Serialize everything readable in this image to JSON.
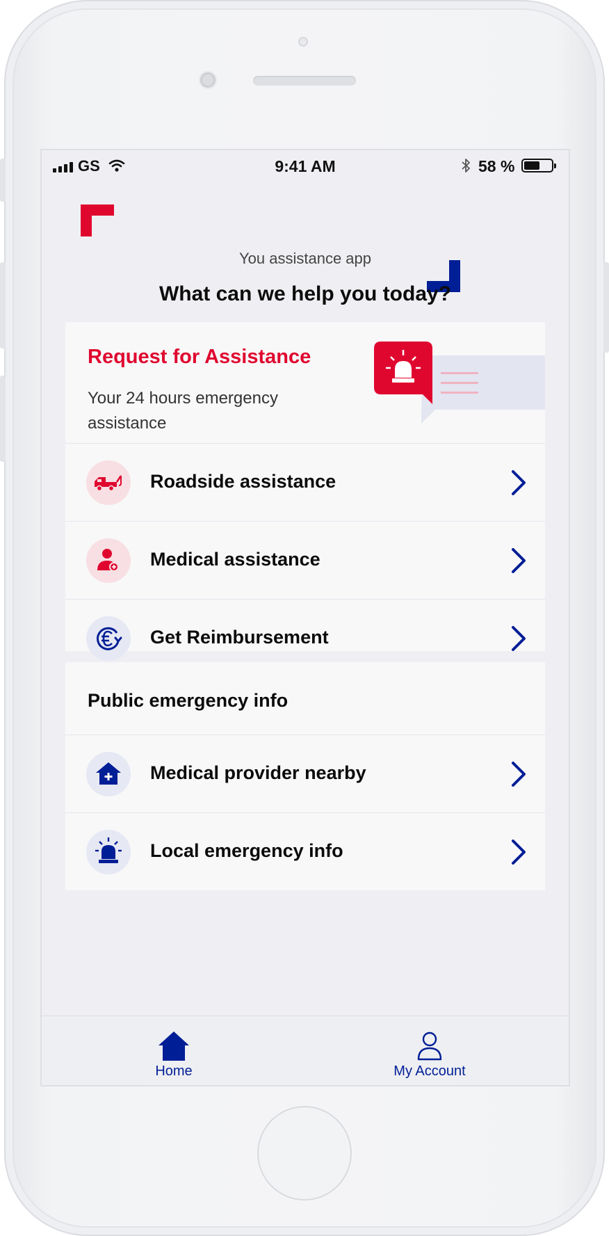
{
  "status_bar": {
    "carrier": "GS",
    "time": "9:41 AM",
    "battery": "58 %",
    "battery_level": 0.58
  },
  "header": {
    "subtitle": "You assistance app",
    "title": "What can we help you today?"
  },
  "request_card": {
    "title": "Request for Assistance",
    "description": "Your 24 hours emergency assistance",
    "items": [
      {
        "label": "Roadside assistance",
        "icon": "tow-truck-icon"
      },
      {
        "label": "Medical assistance",
        "icon": "medical-person-icon"
      },
      {
        "label": "Get Reimbursement",
        "icon": "euro-refund-icon"
      }
    ]
  },
  "public_card": {
    "title": "Public emergency info",
    "items": [
      {
        "label": "Medical provider nearby",
        "icon": "hospital-icon"
      },
      {
        "label": "Local emergency info",
        "icon": "siren-icon"
      }
    ]
  },
  "tab_bar": {
    "tabs": [
      {
        "label": "Home",
        "icon": "home-icon"
      },
      {
        "label": "My Account",
        "icon": "person-icon"
      }
    ]
  },
  "colors": {
    "brand_red": "#e0072f",
    "brand_blue": "#001e96",
    "background": "#efeff3",
    "card": "#f8f8f9"
  }
}
